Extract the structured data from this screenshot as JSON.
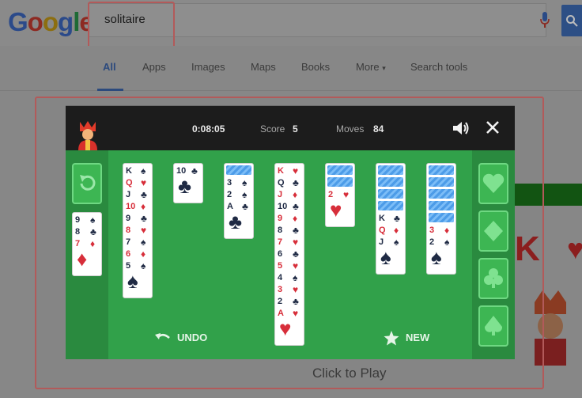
{
  "search": {
    "query": "solitaire"
  },
  "logo": {
    "text": "Google"
  },
  "tabs": [
    "All",
    "Apps",
    "Images",
    "Maps",
    "Books",
    "More",
    "Search tools"
  ],
  "game": {
    "timer": "0:08:05",
    "score_label": "Score",
    "score": "5",
    "moves_label": "Moves",
    "moves": "84",
    "stock_cards": [
      {
        "rank": "9",
        "suit": "♠",
        "color": "black"
      },
      {
        "rank": "8",
        "suit": "♣",
        "color": "black"
      },
      {
        "rank": "7",
        "suit": "♦",
        "color": "red"
      }
    ],
    "columns": [
      {
        "hidden": 0,
        "cards": [
          {
            "rank": "K",
            "suit": "♠",
            "color": "black"
          },
          {
            "rank": "Q",
            "suit": "♥",
            "color": "red"
          },
          {
            "rank": "J",
            "suit": "♣",
            "color": "black"
          },
          {
            "rank": "10",
            "suit": "♦",
            "color": "red"
          },
          {
            "rank": "9",
            "suit": "♣",
            "color": "black"
          },
          {
            "rank": "8",
            "suit": "♥",
            "color": "red"
          },
          {
            "rank": "7",
            "suit": "♠",
            "color": "black"
          },
          {
            "rank": "6",
            "suit": "♦",
            "color": "red"
          },
          {
            "rank": "5",
            "suit": "♠",
            "color": "black"
          }
        ]
      },
      {
        "hidden": 0,
        "cards": [
          {
            "rank": "10",
            "suit": "♣",
            "color": "black"
          }
        ]
      },
      {
        "hidden": 1,
        "cards": [
          {
            "rank": "3",
            "suit": "♠",
            "color": "black"
          },
          {
            "rank": "2",
            "suit": "♠",
            "color": "black"
          },
          {
            "rank": "A",
            "suit": "♣",
            "color": "black"
          }
        ]
      },
      {
        "hidden": 0,
        "cards": [
          {
            "rank": "K",
            "suit": "♥",
            "color": "red"
          },
          {
            "rank": "Q",
            "suit": "♣",
            "color": "black"
          },
          {
            "rank": "J",
            "suit": "♦",
            "color": "red"
          },
          {
            "rank": "10",
            "suit": "♣",
            "color": "black"
          },
          {
            "rank": "9",
            "suit": "♦",
            "color": "red"
          },
          {
            "rank": "8",
            "suit": "♣",
            "color": "black"
          },
          {
            "rank": "7",
            "suit": "♥",
            "color": "red"
          },
          {
            "rank": "6",
            "suit": "♣",
            "color": "black"
          },
          {
            "rank": "5",
            "suit": "♥",
            "color": "red"
          },
          {
            "rank": "4",
            "suit": "♠",
            "color": "black"
          },
          {
            "rank": "3",
            "suit": "♥",
            "color": "red"
          },
          {
            "rank": "2",
            "suit": "♣",
            "color": "black"
          },
          {
            "rank": "A",
            "suit": "♥",
            "color": "red"
          }
        ]
      },
      {
        "hidden": 2,
        "cards": [
          {
            "rank": "2",
            "suit": "♥",
            "color": "red"
          }
        ]
      },
      {
        "hidden": 4,
        "cards": [
          {
            "rank": "K",
            "suit": "♣",
            "color": "black"
          },
          {
            "rank": "Q",
            "suit": "♦",
            "color": "red"
          },
          {
            "rank": "J",
            "suit": "♠",
            "color": "black"
          }
        ]
      },
      {
        "hidden": 5,
        "cards": [
          {
            "rank": "3",
            "suit": "♦",
            "color": "red"
          },
          {
            "rank": "2",
            "suit": "♠",
            "color": "black"
          }
        ]
      }
    ],
    "foundations": [
      "heart",
      "diamond",
      "club",
      "spade"
    ],
    "undo_label": "UNDO",
    "new_label": "NEW"
  },
  "click_to_play": "Click to Play",
  "colors": {
    "felt": "#31a14a",
    "felt_side": "#2a8a3f",
    "red_suit": "#d72e3a",
    "black_suit": "#1f2a44"
  }
}
